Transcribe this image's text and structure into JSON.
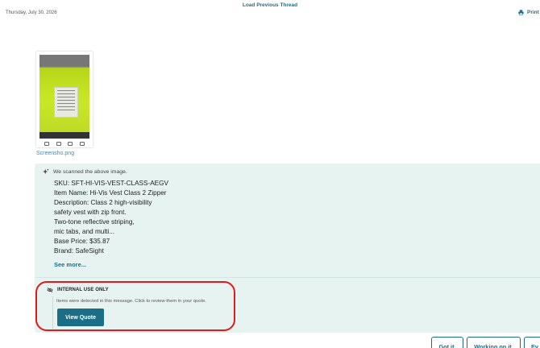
{
  "header": {
    "load_previous": "Load Previous Thread",
    "date": "Thursday, July 30, 2026",
    "print_label": "Print"
  },
  "attachment": {
    "filename": "Screensho.png"
  },
  "ai_scan": {
    "heading": "We scanned the above image.",
    "lines": [
      "SKU: SFT-HI-VIS-VEST-CLASS-AEGV",
      "Item Name: Hi-Vis Vest Class 2 Zipper",
      "Description: Class 2 high-visibility",
      "safety vest with zip front.",
      "Two-tone reflective striping,",
      "mic tabs, and multi...",
      "Base Price: $35.87",
      "Brand: SafeSight"
    ],
    "see_more": "See more..."
  },
  "internal": {
    "title": "INTERNAL USE ONLY",
    "message": "Items were detected in this message. Click to review them in your quote.",
    "button": "View Quote"
  },
  "quick_replies": {
    "got_it": "Got it.",
    "working": "Working on it.",
    "ev": "Ev"
  },
  "colors": {
    "accent": "#1c6e87",
    "panel_bg": "#e7f3f0",
    "highlight": "#e01b1b",
    "link": "#3a8fb7"
  }
}
